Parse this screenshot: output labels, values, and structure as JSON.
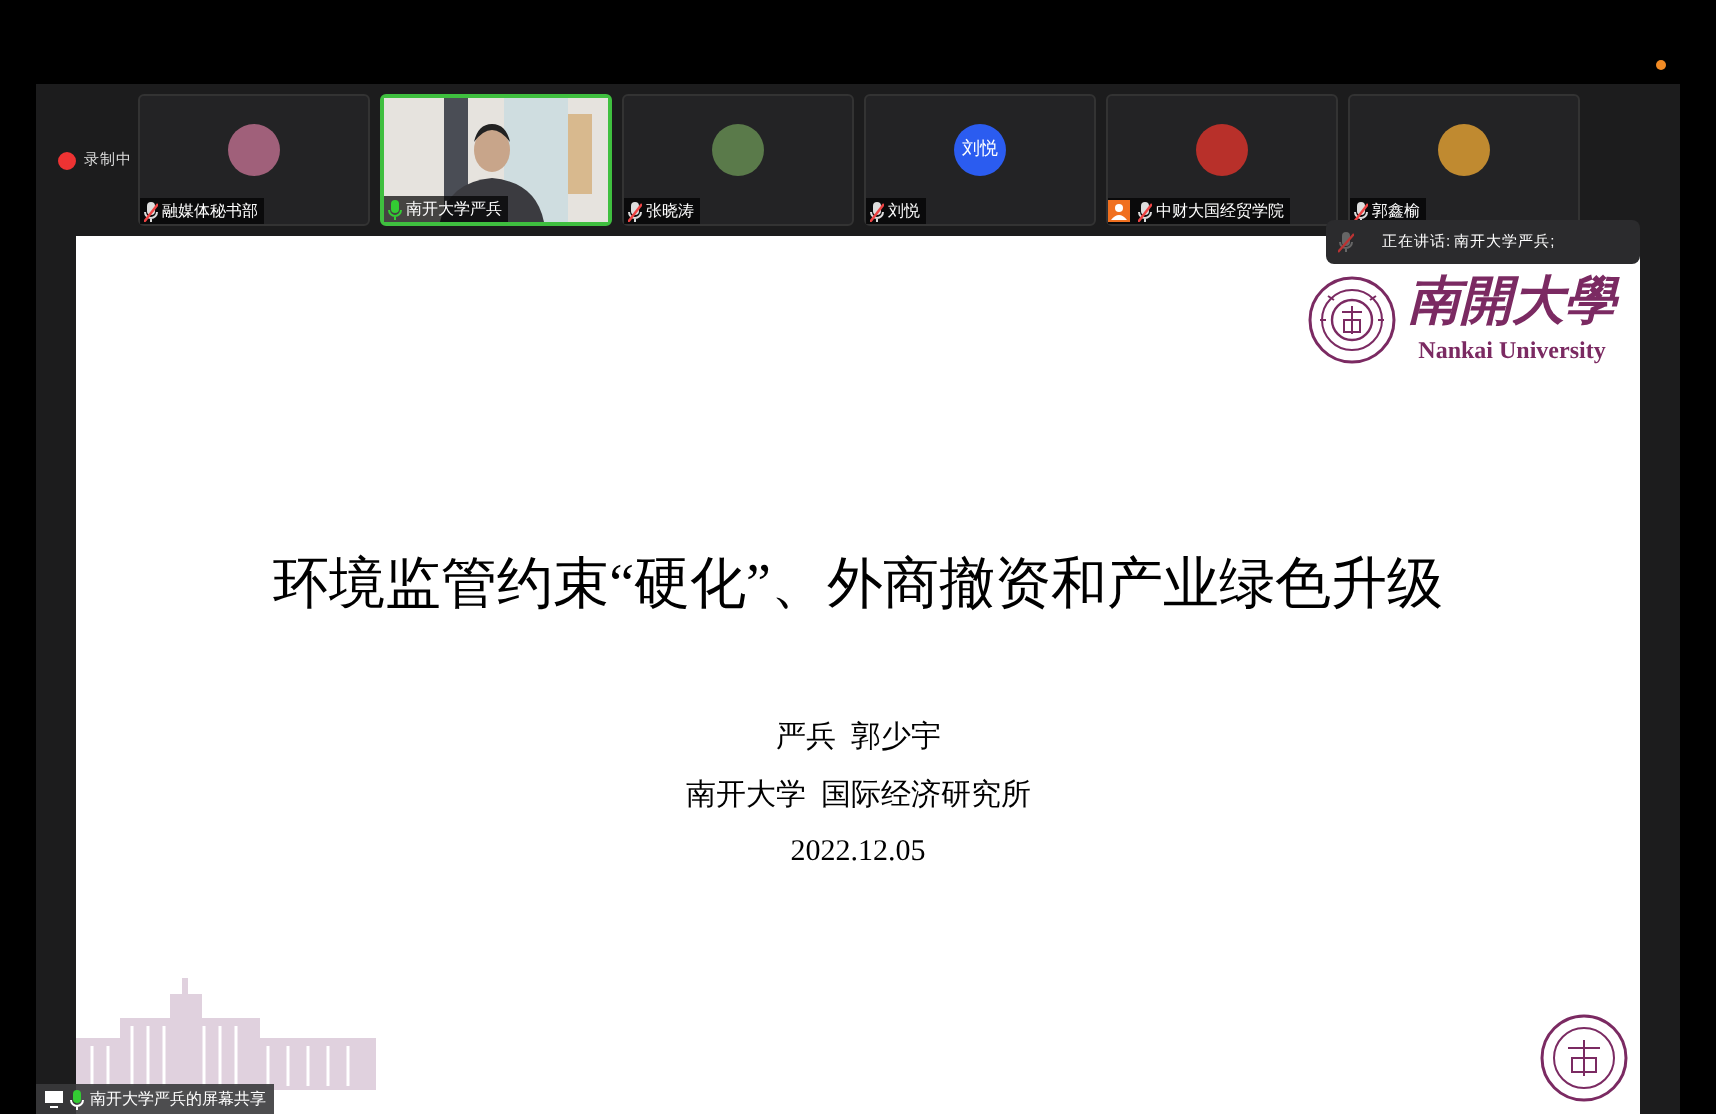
{
  "notification_dot": {
    "color": "#f08a24"
  },
  "recording": {
    "label": "录制中",
    "on": true
  },
  "participants": [
    {
      "name": "融媒体秘书部",
      "kind": "avatar",
      "color": "#a0607a",
      "muted": true,
      "active": false,
      "host": false
    },
    {
      "name": "南开大学严兵",
      "kind": "video",
      "muted": false,
      "active": true,
      "host": false
    },
    {
      "name": "张晓涛",
      "kind": "avatar",
      "color": "#5a7a4a",
      "muted": true,
      "active": false,
      "host": false
    },
    {
      "name": "刘悦",
      "kind": "initials",
      "initials": "刘悦",
      "color": "#2b5cf0",
      "muted": true,
      "active": false,
      "host": false
    },
    {
      "name": "中财大国经贸学院",
      "kind": "avatar",
      "color": "#b8302a",
      "muted": true,
      "active": false,
      "host": true
    },
    {
      "name": "郭鑫榆",
      "kind": "avatar",
      "color": "#c08a30",
      "muted": true,
      "active": false,
      "host": false
    }
  ],
  "speaking_banner": {
    "text": "正在讲话: 南开大学严兵;"
  },
  "slide": {
    "logo": {
      "name_cn": "南開大學",
      "name_en": "Nankai University"
    },
    "title": "环境监管约束“硬化”、外商撤资和产业绿色升级",
    "authors": "严兵  郭少宇",
    "affiliation": "南开大学  国际经济研究所",
    "date": "2022.12.05"
  },
  "share_label": {
    "text": "南开大学严兵的屏幕共享",
    "muted": false
  }
}
